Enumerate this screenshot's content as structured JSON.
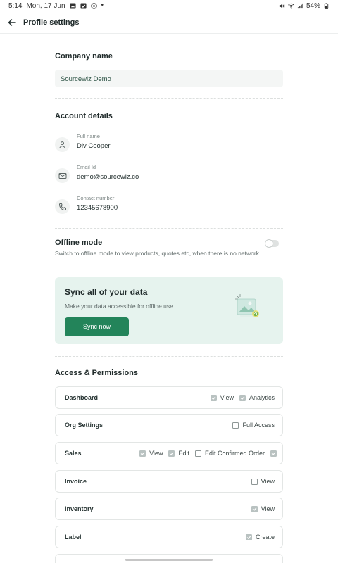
{
  "status_bar": {
    "time": "5:14",
    "date": "Mon, 17 Jun",
    "battery": "54%"
  },
  "header": {
    "title": "Profile settings",
    "back_icon": "arrow-left-icon"
  },
  "company": {
    "title": "Company name",
    "value": "Sourcewiz Demo"
  },
  "account": {
    "title": "Account details",
    "fields": [
      {
        "label": "Full name",
        "value": "Div Cooper",
        "icon": "user-icon"
      },
      {
        "label": "Email Id",
        "value": "demo@sourcewiz.co",
        "icon": "mail-icon"
      },
      {
        "label": "Contact number",
        "value": "12345678900",
        "icon": "phone-icon"
      }
    ]
  },
  "offline": {
    "title": "Offline mode",
    "description": "Switch to offline mode to view products, quotes etc, when there is no network",
    "enabled": false
  },
  "sync": {
    "title": "Sync all of your data",
    "subtitle": "Make your data accessible for offline use",
    "button_label": "Sync now",
    "illustration": "image-sync-icon"
  },
  "access": {
    "title": "Access & Permissions",
    "rows": [
      {
        "name": "Dashboard",
        "options": [
          {
            "label": "View",
            "checked": true
          },
          {
            "label": "Analytics",
            "checked": true
          }
        ]
      },
      {
        "name": "Org Settings",
        "options": [
          {
            "label": "Full Access",
            "checked": false
          }
        ]
      },
      {
        "name": "Sales",
        "options": [
          {
            "label": "View",
            "checked": true
          },
          {
            "label": "Edit",
            "checked": true
          },
          {
            "label": "Edit Confirmed Order",
            "checked": false
          },
          {
            "label": "",
            "checked": true
          }
        ]
      },
      {
        "name": "Invoice",
        "options": [
          {
            "label": "View",
            "checked": false
          }
        ]
      },
      {
        "name": "Inventory",
        "options": [
          {
            "label": "View",
            "checked": true
          }
        ]
      },
      {
        "name": "Label",
        "options": [
          {
            "label": "Create",
            "checked": true
          }
        ]
      }
    ]
  },
  "colors": {
    "accent": "#23845a",
    "sync_card_bg": "#e6f3ee",
    "input_bg": "#f4f6f5",
    "checkbox_checked": "#b9c2c1"
  }
}
